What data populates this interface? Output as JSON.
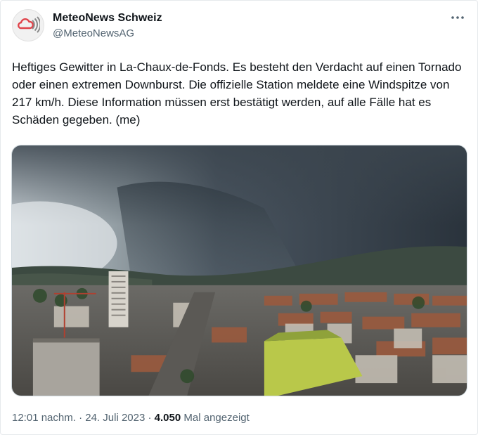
{
  "tweet": {
    "author": {
      "display_name": "MeteoNews Schweiz",
      "handle": "@MeteoNewsAG",
      "avatar_icon": "cloud-broadcast-logo"
    },
    "more_icon": "more-horizontal-icon",
    "text": "Heftiges Gewitter in La-Chaux-de-Fonds. Es besteht den Verdacht auf einen Tornado oder einen extremen Downburst. Die offizielle Station meldete eine Windspitze von 217 km/h. Diese Information müssen erst bestätigt werden, auf alle Fälle hat es Schäden gegeben. (me)",
    "media": {
      "subject": "storm-cloud-over-city-photo"
    },
    "meta": {
      "time": "12:01 nachm.",
      "separator": "·",
      "date": "24. Juli 2023",
      "views_count": "4.050",
      "views_label": "Mal angezeigt"
    },
    "colors": {
      "text": "#0f1419",
      "secondary": "#536471",
      "logo_red": "#e0434a"
    }
  }
}
